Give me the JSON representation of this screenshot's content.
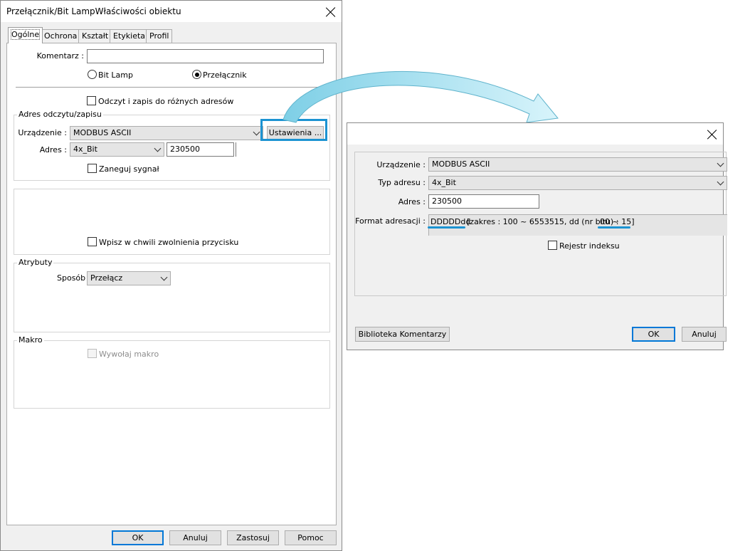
{
  "main_dialog": {
    "title": "Przełącznik/Bit LampWłaściwości obiektu",
    "tabs": [
      "Ogólne",
      "Ochrona",
      "Kształt",
      "Etykieta",
      "Profil"
    ],
    "comment_label": "Komentarz :",
    "comment_value": "",
    "radio_bit_lamp": "Bit Lamp",
    "radio_switch": "Przełącznik",
    "checkbox_rw_different": "Odczyt i zapis do różnych adresów",
    "group_rw_address": "Adres odczytu/zapisu",
    "device_label": "Urządzenie :",
    "device_value": "MODBUS ASCII",
    "settings_button": "Ustawienia ...",
    "address_label": "Adres :",
    "address_type_value": "4x_Bit",
    "address_value": "230500",
    "invert_signal": "Zaneguj sygnał",
    "write_on_release": "Wpisz w chwili zwolnienia przycisku",
    "group_attributes": "Atrybuty",
    "mode_label": "Sposób",
    "mode_value": "Przełącz",
    "group_macro": "Makro",
    "call_macro": "Wywołaj makro",
    "btn_ok": "OK",
    "btn_cancel": "Anuluj",
    "btn_apply": "Zastosuj",
    "btn_help": "Pomoc"
  },
  "settings_dialog": {
    "device_label": "Urządzenie :",
    "device_value": "MODBUS ASCII",
    "address_type_label": "Typ adresu :",
    "address_type_value": "4x_Bit",
    "address_label": "Adres :",
    "address_value": "230500",
    "format_label": "Format adresacji :",
    "format_code": "DDDDDdd",
    "format_range_text": "[zakres : 100 ~ 6553515, dd (nr bitu) :",
    "format_bit_range": "00 ~ 15]",
    "index_register": "Rejestr indeksu",
    "btn_comment_library": "Biblioteka Komentarzy",
    "btn_ok": "OK",
    "btn_cancel": "Anuluj"
  },
  "colors": {
    "highlight_border": "#1c93d2",
    "arrow_fill": "#9fe3f3",
    "default_button_border": "#0078d7"
  }
}
